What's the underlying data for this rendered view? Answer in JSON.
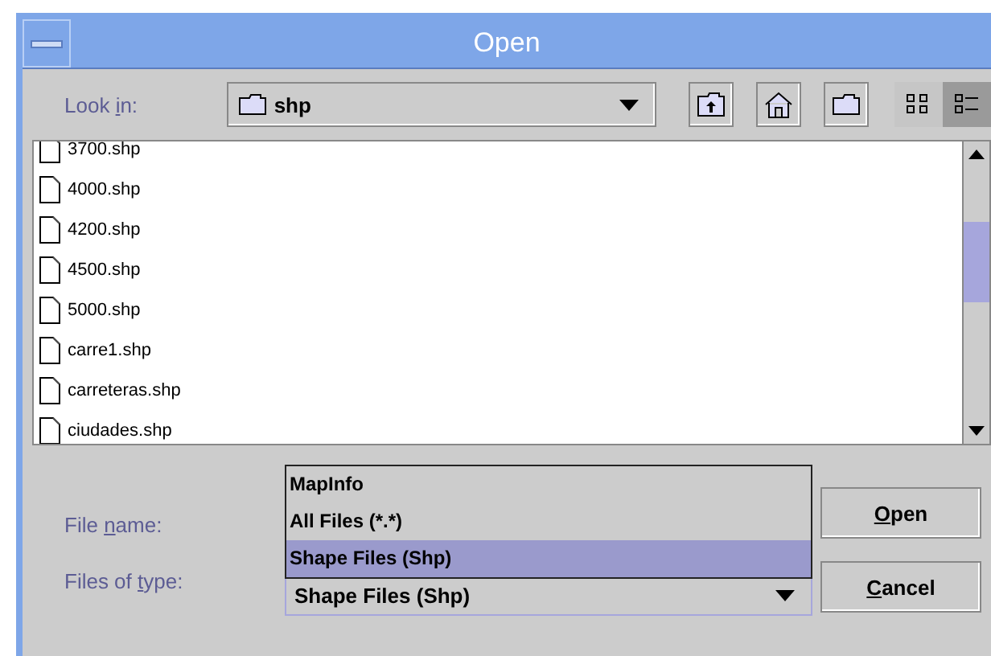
{
  "window": {
    "title": "Open"
  },
  "look_in": {
    "label": {
      "before": "Look ",
      "key": "i",
      "after": "n:"
    },
    "value": "shp"
  },
  "files": [
    {
      "name": "3700.shp"
    },
    {
      "name": "4000.shp"
    },
    {
      "name": "4200.shp"
    },
    {
      "name": "4500.shp"
    },
    {
      "name": "5000.shp"
    },
    {
      "name": "carre1.shp"
    },
    {
      "name": "carreteras.shp"
    },
    {
      "name": "ciudades.shp"
    }
  ],
  "file_name": {
    "label": {
      "before": "File ",
      "key": "n",
      "after": "ame:"
    }
  },
  "file_type": {
    "label": {
      "before": "Files of ",
      "key": "t",
      "after": "ype:"
    },
    "value": "Shape Files (Shp)",
    "expanded": true,
    "options": [
      {
        "label": "MapInfo",
        "selected": false
      },
      {
        "label": "All Files (*.*)",
        "selected": false
      },
      {
        "label": "Shape Files (Shp)",
        "selected": true
      }
    ]
  },
  "buttons": [
    {
      "key": "O",
      "after": "pen"
    },
    {
      "key": "C",
      "after": "ancel"
    }
  ],
  "view": {
    "list_selected": false,
    "details_selected": true
  }
}
